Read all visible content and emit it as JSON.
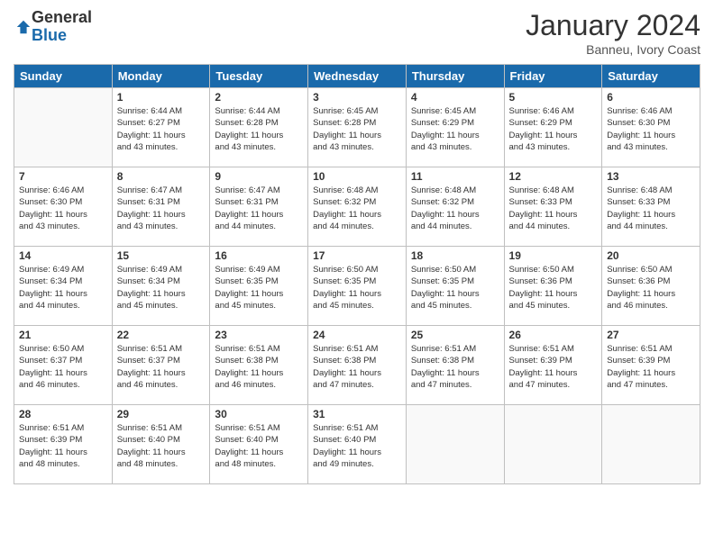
{
  "logo": {
    "general": "General",
    "blue": "Blue"
  },
  "header": {
    "month": "January 2024",
    "location": "Banneu, Ivory Coast"
  },
  "days_of_week": [
    "Sunday",
    "Monday",
    "Tuesday",
    "Wednesday",
    "Thursday",
    "Friday",
    "Saturday"
  ],
  "weeks": [
    [
      {
        "day": "",
        "info": ""
      },
      {
        "day": "1",
        "info": "Sunrise: 6:44 AM\nSunset: 6:27 PM\nDaylight: 11 hours\nand 43 minutes."
      },
      {
        "day": "2",
        "info": "Sunrise: 6:44 AM\nSunset: 6:28 PM\nDaylight: 11 hours\nand 43 minutes."
      },
      {
        "day": "3",
        "info": "Sunrise: 6:45 AM\nSunset: 6:28 PM\nDaylight: 11 hours\nand 43 minutes."
      },
      {
        "day": "4",
        "info": "Sunrise: 6:45 AM\nSunset: 6:29 PM\nDaylight: 11 hours\nand 43 minutes."
      },
      {
        "day": "5",
        "info": "Sunrise: 6:46 AM\nSunset: 6:29 PM\nDaylight: 11 hours\nand 43 minutes."
      },
      {
        "day": "6",
        "info": "Sunrise: 6:46 AM\nSunset: 6:30 PM\nDaylight: 11 hours\nand 43 minutes."
      }
    ],
    [
      {
        "day": "7",
        "info": "Sunrise: 6:46 AM\nSunset: 6:30 PM\nDaylight: 11 hours\nand 43 minutes."
      },
      {
        "day": "8",
        "info": "Sunrise: 6:47 AM\nSunset: 6:31 PM\nDaylight: 11 hours\nand 43 minutes."
      },
      {
        "day": "9",
        "info": "Sunrise: 6:47 AM\nSunset: 6:31 PM\nDaylight: 11 hours\nand 44 minutes."
      },
      {
        "day": "10",
        "info": "Sunrise: 6:48 AM\nSunset: 6:32 PM\nDaylight: 11 hours\nand 44 minutes."
      },
      {
        "day": "11",
        "info": "Sunrise: 6:48 AM\nSunset: 6:32 PM\nDaylight: 11 hours\nand 44 minutes."
      },
      {
        "day": "12",
        "info": "Sunrise: 6:48 AM\nSunset: 6:33 PM\nDaylight: 11 hours\nand 44 minutes."
      },
      {
        "day": "13",
        "info": "Sunrise: 6:48 AM\nSunset: 6:33 PM\nDaylight: 11 hours\nand 44 minutes."
      }
    ],
    [
      {
        "day": "14",
        "info": "Sunrise: 6:49 AM\nSunset: 6:34 PM\nDaylight: 11 hours\nand 44 minutes."
      },
      {
        "day": "15",
        "info": "Sunrise: 6:49 AM\nSunset: 6:34 PM\nDaylight: 11 hours\nand 45 minutes."
      },
      {
        "day": "16",
        "info": "Sunrise: 6:49 AM\nSunset: 6:35 PM\nDaylight: 11 hours\nand 45 minutes."
      },
      {
        "day": "17",
        "info": "Sunrise: 6:50 AM\nSunset: 6:35 PM\nDaylight: 11 hours\nand 45 minutes."
      },
      {
        "day": "18",
        "info": "Sunrise: 6:50 AM\nSunset: 6:35 PM\nDaylight: 11 hours\nand 45 minutes."
      },
      {
        "day": "19",
        "info": "Sunrise: 6:50 AM\nSunset: 6:36 PM\nDaylight: 11 hours\nand 45 minutes."
      },
      {
        "day": "20",
        "info": "Sunrise: 6:50 AM\nSunset: 6:36 PM\nDaylight: 11 hours\nand 46 minutes."
      }
    ],
    [
      {
        "day": "21",
        "info": "Sunrise: 6:50 AM\nSunset: 6:37 PM\nDaylight: 11 hours\nand 46 minutes."
      },
      {
        "day": "22",
        "info": "Sunrise: 6:51 AM\nSunset: 6:37 PM\nDaylight: 11 hours\nand 46 minutes."
      },
      {
        "day": "23",
        "info": "Sunrise: 6:51 AM\nSunset: 6:38 PM\nDaylight: 11 hours\nand 46 minutes."
      },
      {
        "day": "24",
        "info": "Sunrise: 6:51 AM\nSunset: 6:38 PM\nDaylight: 11 hours\nand 47 minutes."
      },
      {
        "day": "25",
        "info": "Sunrise: 6:51 AM\nSunset: 6:38 PM\nDaylight: 11 hours\nand 47 minutes."
      },
      {
        "day": "26",
        "info": "Sunrise: 6:51 AM\nSunset: 6:39 PM\nDaylight: 11 hours\nand 47 minutes."
      },
      {
        "day": "27",
        "info": "Sunrise: 6:51 AM\nSunset: 6:39 PM\nDaylight: 11 hours\nand 47 minutes."
      }
    ],
    [
      {
        "day": "28",
        "info": "Sunrise: 6:51 AM\nSunset: 6:39 PM\nDaylight: 11 hours\nand 48 minutes."
      },
      {
        "day": "29",
        "info": "Sunrise: 6:51 AM\nSunset: 6:40 PM\nDaylight: 11 hours\nand 48 minutes."
      },
      {
        "day": "30",
        "info": "Sunrise: 6:51 AM\nSunset: 6:40 PM\nDaylight: 11 hours\nand 48 minutes."
      },
      {
        "day": "31",
        "info": "Sunrise: 6:51 AM\nSunset: 6:40 PM\nDaylight: 11 hours\nand 49 minutes."
      },
      {
        "day": "",
        "info": ""
      },
      {
        "day": "",
        "info": ""
      },
      {
        "day": "",
        "info": ""
      }
    ]
  ]
}
